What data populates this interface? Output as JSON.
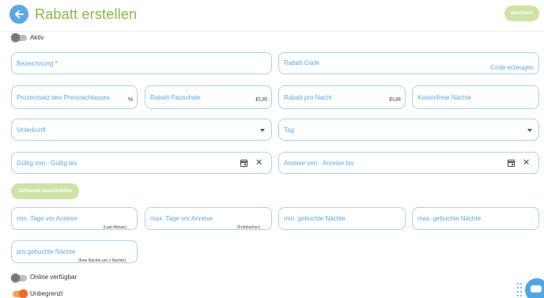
{
  "header": {
    "title": "Rabatt erstellen",
    "save_label": "speichern"
  },
  "toggles": {
    "active": {
      "label": "Aktiv",
      "on": false
    },
    "online": {
      "label": "Online verfügbar",
      "on": false
    },
    "unlimited": {
      "label": "Unbegrenzt",
      "on": true
    }
  },
  "fields": {
    "name": {
      "label": "Bezeichnung",
      "required_mark": "*"
    },
    "code": {
      "label": "Rabatt Code",
      "action": "Code erzeugen"
    },
    "percent": {
      "label": "Prozentsatz des Preisnachlasses",
      "suffix": "%"
    },
    "flat": {
      "label": "Rabatt-Pauschale",
      "suffix": "EUR"
    },
    "per_night": {
      "label": "Rabatt pro Nacht",
      "suffix": "EUR"
    },
    "free_nights": {
      "label": "Kostenfreie Nächte"
    },
    "accommodation": {
      "label": "Unterkunft"
    },
    "day": {
      "label": "Tag"
    },
    "valid_range": {
      "label": "Gültig von - Gültig bis"
    },
    "arrival_range": {
      "label": "Anreise von - Anreise bis"
    },
    "min_days": {
      "label": "min. Tage vor Anreise",
      "hint": "(Last-Minute)"
    },
    "max_days": {
      "label": "max. Tage vor Anreise",
      "hint": "(Frühbucher)"
    },
    "min_nights": {
      "label": "min. gebuchte Nächte"
    },
    "max_nights": {
      "label": "max. gebuchte Nächte"
    },
    "per_booked": {
      "label": "pro gebuchte Nächte",
      "hint": "(freie Nächte pro x Nächte)"
    }
  },
  "buttons": {
    "exclude_periods": "Zeiträume ausschließen"
  },
  "colors": {
    "title_green": "#8ab84a",
    "accent_blue": "#5aa9e6",
    "button_green": "#cfe3a6",
    "toggle_on": "#f26c1d"
  },
  "icons": {
    "back": "arrow-left-icon",
    "calendar": "calendar-icon",
    "clear": "close-icon",
    "dropdown": "caret-down-icon",
    "chat": "chat-icon"
  }
}
